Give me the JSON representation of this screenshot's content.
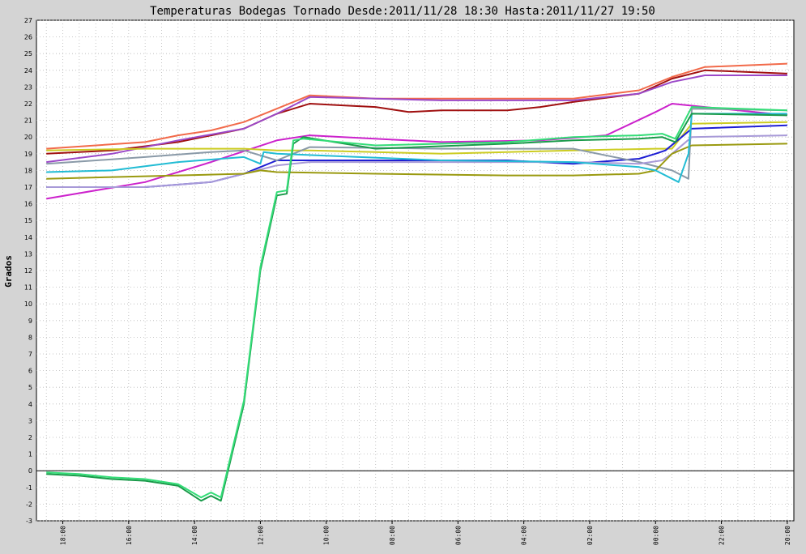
{
  "chart_data": {
    "type": "line",
    "title": "Temperaturas Bodegas Tornado Desde:2011/11/28 18:30 Hasta:2011/11/27 19:50",
    "ylabel": "Grados",
    "xlabel": "",
    "ylim": [
      -3,
      27
    ],
    "yticks": [
      -3,
      -2,
      -1,
      0,
      1,
      2,
      3,
      4,
      5,
      6,
      7,
      8,
      9,
      10,
      11,
      12,
      13,
      14,
      15,
      16,
      17,
      18,
      19,
      20,
      21,
      22,
      23,
      24,
      25,
      26,
      27
    ],
    "x_reversed": true,
    "x_unit": "hours before 2011/11/28 18:30",
    "xlim": [
      -0.3,
      22.7
    ],
    "xtick_labels": [
      "18:00",
      "16:00",
      "14:00",
      "12:00",
      "10:00",
      "08:00",
      "06:00",
      "04:00",
      "02:00",
      "00:00",
      "22:00",
      "20:00"
    ],
    "grid": true,
    "zero_line": true,
    "series": [
      {
        "color": "#f26a4a",
        "x": [
          0,
          3,
          4,
          5,
          6,
          8,
          10,
          12,
          14,
          16,
          18,
          19,
          20,
          22.5
        ],
        "y": [
          19.3,
          19.7,
          20.1,
          20.4,
          20.9,
          22.5,
          22.3,
          22.3,
          22.3,
          22.3,
          22.8,
          23.6,
          24.2,
          24.4
        ]
      },
      {
        "color": "#a01010",
        "x": [
          0,
          2,
          4,
          6,
          7,
          8,
          9,
          10,
          11,
          12,
          14,
          15,
          16,
          18,
          19,
          20,
          22.5
        ],
        "y": [
          19.0,
          19.2,
          19.7,
          20.5,
          21.4,
          22.0,
          21.9,
          21.8,
          21.5,
          21.6,
          21.6,
          21.8,
          22.1,
          22.6,
          23.5,
          24.0,
          23.8
        ]
      },
      {
        "color": "#9b48c8",
        "x": [
          0,
          2,
          4,
          6,
          7,
          8,
          10,
          12,
          14,
          16,
          18,
          19,
          20,
          22.5
        ],
        "y": [
          18.5,
          19.0,
          19.8,
          20.5,
          21.4,
          22.4,
          22.3,
          22.2,
          22.2,
          22.2,
          22.6,
          23.3,
          23.7,
          23.7
        ]
      },
      {
        "color": "#cc22cc",
        "x": [
          0,
          3,
          5,
          7,
          8,
          9,
          12,
          15,
          17,
          18.5,
          19,
          22.5
        ],
        "y": [
          16.3,
          17.3,
          18.5,
          19.8,
          20.1,
          20.0,
          19.7,
          19.8,
          20.1,
          21.5,
          22.0,
          21.3
        ]
      },
      {
        "color": "#cccc22",
        "x": [
          0,
          3,
          6,
          7,
          8,
          12,
          16,
          18.5,
          19,
          19.6,
          22.5
        ],
        "y": [
          19.2,
          19.3,
          19.3,
          19.2,
          19.2,
          19.0,
          19.2,
          19.3,
          19.3,
          20.8,
          20.9
        ]
      },
      {
        "color": "#1e1ed4",
        "x": [
          0,
          3,
          5,
          6,
          6.5,
          7,
          10,
          14,
          16,
          18,
          18.5,
          18.8,
          19.6,
          22.5
        ],
        "y": [
          17.0,
          17.0,
          17.3,
          17.8,
          18.2,
          18.6,
          18.6,
          18.6,
          18.4,
          18.7,
          19.0,
          19.2,
          20.5,
          20.7
        ]
      },
      {
        "color": "#8a9aa8",
        "x": [
          0,
          3,
          5,
          6,
          7,
          8,
          12,
          16,
          18,
          19,
          19.5,
          19.6,
          22.5
        ],
        "y": [
          18.4,
          18.8,
          19.1,
          19.2,
          18.6,
          19.4,
          19.3,
          19.3,
          18.5,
          18.0,
          17.5,
          21.7,
          21.6
        ]
      },
      {
        "color": "#a89ad8",
        "x": [
          0,
          3,
          5,
          6,
          7,
          8,
          12,
          16,
          18,
          18.7,
          19,
          19.6,
          22.5
        ],
        "y": [
          17.0,
          17.0,
          17.3,
          17.8,
          18.3,
          18.5,
          18.5,
          18.5,
          18.4,
          18.6,
          19.0,
          20.0,
          20.1
        ]
      },
      {
        "color": "#9a9a10",
        "x": [
          0,
          2,
          4,
          6,
          6.5,
          7,
          10,
          14,
          16,
          18,
          18.5,
          19,
          19.6,
          22.5
        ],
        "y": [
          17.5,
          17.6,
          17.7,
          17.8,
          18.0,
          17.9,
          17.8,
          17.7,
          17.7,
          17.8,
          18.0,
          19.0,
          19.5,
          19.6
        ]
      },
      {
        "color": "#22bcd4",
        "x": [
          0,
          2,
          4,
          6,
          6.5,
          6.6,
          7,
          12,
          16,
          18,
          18.5,
          19,
          19.2,
          19.5,
          19.6,
          22.5
        ],
        "y": [
          17.9,
          18.0,
          18.5,
          18.8,
          18.4,
          19.1,
          19.0,
          18.6,
          18.5,
          18.2,
          18.0,
          17.5,
          17.3,
          19.0,
          21.4,
          21.4
        ]
      },
      {
        "color": "#1a9a4a",
        "x": [
          0,
          1,
          2,
          3,
          4,
          4.7,
          5,
          5.3,
          6,
          6.5,
          7,
          7.3,
          7.5,
          7.8,
          10,
          14,
          16,
          18,
          18.7,
          19.1,
          19.6,
          22.5
        ],
        "y": [
          -0.2,
          -0.3,
          -0.5,
          -0.6,
          -0.9,
          -1.8,
          -1.5,
          -1.8,
          4.0,
          12.0,
          16.5,
          16.6,
          19.6,
          20.0,
          19.3,
          19.6,
          19.8,
          19.9,
          20.0,
          19.7,
          21.4,
          21.3
        ]
      },
      {
        "color": "#33dd77",
        "x": [
          0,
          1,
          2,
          3,
          4,
          4.7,
          5,
          5.3,
          6,
          6.5,
          7,
          7.3,
          7.5,
          7.8,
          10,
          14,
          16,
          18,
          18.7,
          19.1,
          19.6,
          22.5
        ],
        "y": [
          -0.1,
          -0.2,
          -0.4,
          -0.5,
          -0.8,
          -1.6,
          -1.3,
          -1.6,
          4.2,
          12.2,
          16.7,
          16.8,
          19.8,
          19.9,
          19.5,
          19.7,
          20.0,
          20.1,
          20.2,
          19.9,
          21.8,
          21.6
        ]
      }
    ]
  }
}
